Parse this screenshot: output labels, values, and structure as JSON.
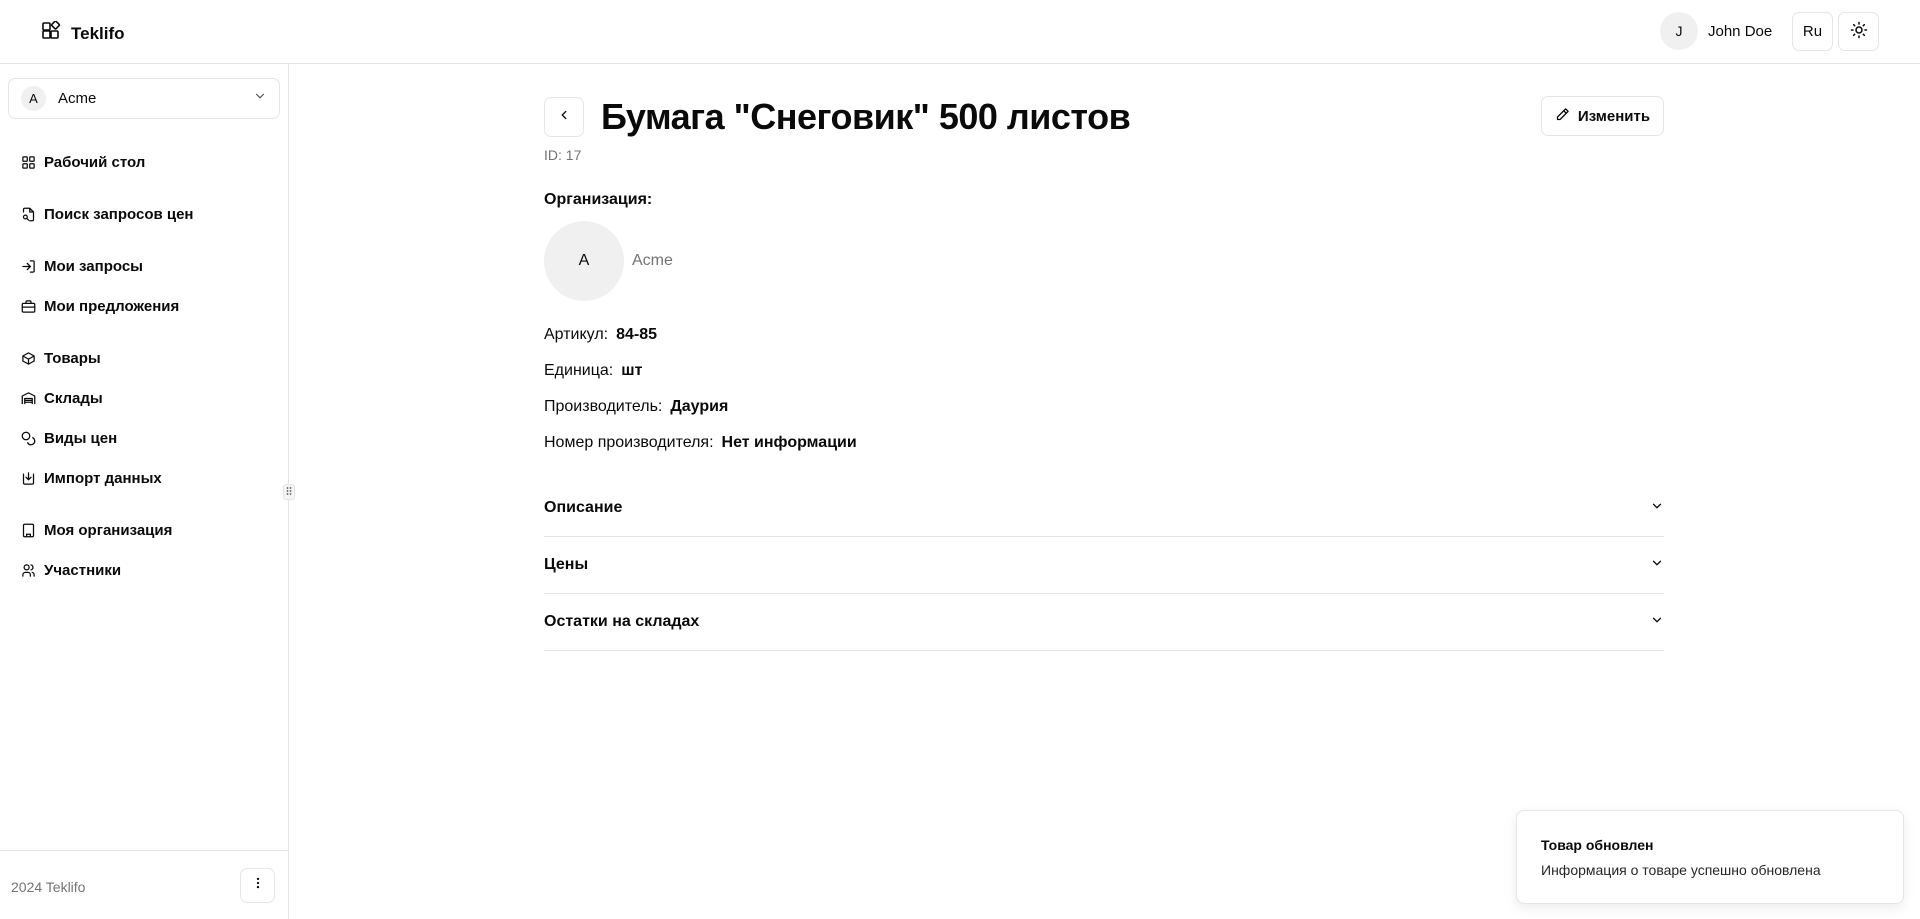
{
  "header": {
    "app_name": "Teklifo",
    "user_initial": "J",
    "user_name": "John Doe",
    "language": "Ru"
  },
  "sidebar": {
    "org_initial": "A",
    "org_name": "Acme",
    "items": [
      {
        "label": "Рабочий стол",
        "icon": "dashboard-icon"
      },
      {
        "label": "Поиск запросов цен",
        "icon": "file-search-icon"
      },
      {
        "label": "Мои запросы",
        "icon": "log-in-icon"
      },
      {
        "label": "Мои предложения",
        "icon": "briefcase-icon"
      },
      {
        "label": "Товары",
        "icon": "box-icon"
      },
      {
        "label": "Склады",
        "icon": "warehouse-icon"
      },
      {
        "label": "Виды цен",
        "icon": "coins-icon"
      },
      {
        "label": "Импорт данных",
        "icon": "import-icon"
      },
      {
        "label": "Моя организация",
        "icon": "building-icon"
      },
      {
        "label": "Участники",
        "icon": "users-icon"
      }
    ],
    "footer": "2024 Teklifo"
  },
  "product": {
    "title": "Бумага \"Снеговик\" 500 листов",
    "id_text": "ID: 17",
    "edit_label": "Изменить",
    "org_label": "Организация:",
    "org_initial": "A",
    "org_name": "Acme",
    "properties": [
      {
        "label": "Артикул:",
        "value": "84-85"
      },
      {
        "label": "Единица:",
        "value": "шт"
      },
      {
        "label": "Производитель:",
        "value": "Даурия"
      },
      {
        "label": "Номер производителя:",
        "value": "Нет информации"
      }
    ],
    "sections": [
      "Описание",
      "Цены",
      "Остатки на складах"
    ]
  },
  "toast": {
    "title": "Товар обновлен",
    "description": "Информация о товаре успешно обновлена"
  }
}
